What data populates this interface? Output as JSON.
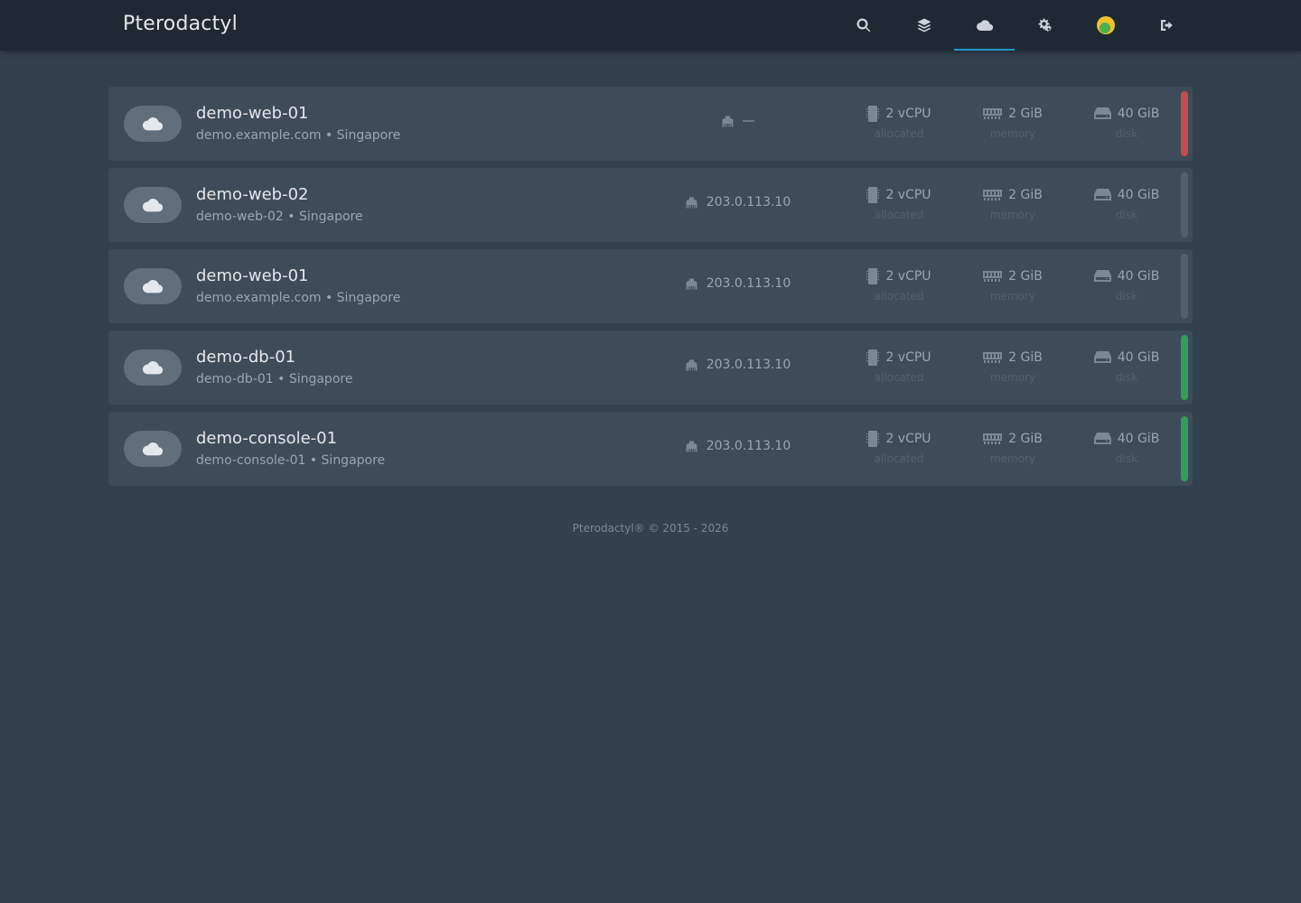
{
  "navbar": {
    "brand": "Pterodactyl",
    "links": [
      {
        "icon": "search-icon"
      },
      {
        "icon": "layers-icon"
      },
      {
        "icon": "cloud-icon",
        "active": true
      },
      {
        "icon": "cogs-icon"
      },
      {
        "icon": "avatar"
      },
      {
        "icon": "sign-out-icon"
      }
    ]
  },
  "servers": [
    {
      "name": "demo-web-01",
      "description": "demo.example.com • Singapore",
      "ip": "—",
      "cpu": "2 vCPU",
      "cpu_label": "allocated",
      "memory": "2 GiB",
      "memory_label": "memory",
      "disk": "40 GiB",
      "disk_label": "disk",
      "status": "offline",
      "status_color": "#c94a4a"
    },
    {
      "name": "demo-web-02",
      "description": "demo-web-02 • Singapore",
      "ip": "203.0.113.10",
      "cpu": "2 vCPU",
      "cpu_label": "allocated",
      "memory": "2 GiB",
      "memory_label": "memory",
      "disk": "40 GiB",
      "disk_label": "disk",
      "status": "unknown",
      "status_color": "#52606d"
    },
    {
      "name": "demo-web-01",
      "description": "demo.example.com • Singapore",
      "ip": "203.0.113.10",
      "cpu": "2 vCPU",
      "cpu_label": "allocated",
      "memory": "2 GiB",
      "memory_label": "memory",
      "disk": "40 GiB",
      "disk_label": "disk",
      "status": "unknown",
      "status_color": "#52606d"
    },
    {
      "name": "demo-db-01",
      "description": "demo-db-01 • Singapore",
      "ip": "203.0.113.10",
      "cpu": "2 vCPU",
      "cpu_label": "allocated",
      "memory": "2 GiB",
      "memory_label": "memory",
      "disk": "40 GiB",
      "disk_label": "disk",
      "status": "online",
      "status_color": "#2f9e5b"
    },
    {
      "name": "demo-console-01",
      "description": "demo-console-01 • Singapore",
      "ip": "203.0.113.10",
      "cpu": "2 vCPU",
      "cpu_label": "allocated",
      "memory": "2 GiB",
      "memory_label": "memory",
      "disk": "40 GiB",
      "disk_label": "disk",
      "status": "online",
      "status_color": "#2f9e5b"
    }
  ],
  "footer": {
    "text": "Pterodactyl® © 2015 - 2026"
  },
  "colors": {
    "accent": "#1e9bc8",
    "background": "#33404d",
    "card": "#3e4c59",
    "navbar": "#1f2933"
  }
}
